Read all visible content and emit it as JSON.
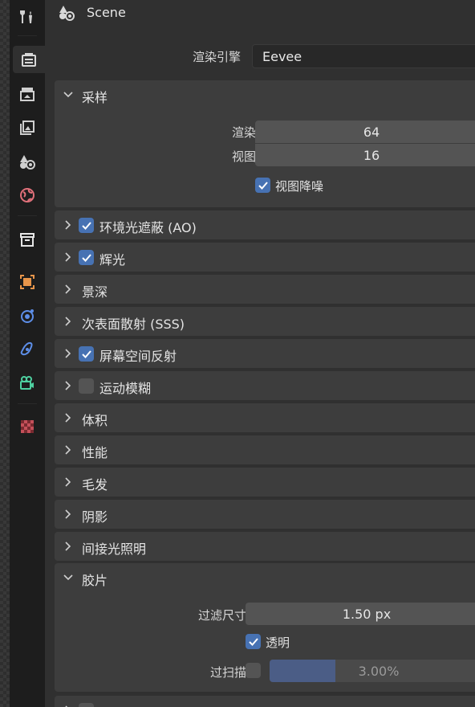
{
  "header": {
    "title": "Scene",
    "icon": "scene-icon"
  },
  "render_engine": {
    "label": "渲染引擎",
    "value": "Eevee"
  },
  "sampling": {
    "title": "采样",
    "render_label": "渲染",
    "render_value": "64",
    "viewport_label": "视图",
    "viewport_value": "16",
    "denoise_label": "视图降噪",
    "denoise_checked": true
  },
  "panels": [
    {
      "title": "环境光遮蔽 (AO)",
      "has_checkbox": true,
      "checked": true
    },
    {
      "title": "辉光",
      "has_checkbox": true,
      "checked": true
    },
    {
      "title": "景深",
      "has_checkbox": false
    },
    {
      "title": "次表面散射 (SSS)",
      "has_checkbox": false
    },
    {
      "title": "屏幕空间反射",
      "has_checkbox": true,
      "checked": true
    },
    {
      "title": "运动模糊",
      "has_checkbox": true,
      "checked": false
    },
    {
      "title": "体积",
      "has_checkbox": false
    },
    {
      "title": "性能",
      "has_checkbox": false
    },
    {
      "title": "毛发",
      "has_checkbox": false
    },
    {
      "title": "阴影",
      "has_checkbox": false
    },
    {
      "title": "间接光照明",
      "has_checkbox": false
    }
  ],
  "film": {
    "title": "胶片",
    "filter_label": "过滤尺寸",
    "filter_value": "1.50 px",
    "transparent_label": "透明",
    "transparent_checked": true,
    "overscan_label": "过扫描",
    "overscan_checked": false,
    "overscan_value": "3.00%",
    "overscan_fraction": 0.3
  },
  "colors": {
    "accent": "#4772b3",
    "panel": "#3d3d3d",
    "field": "#545454",
    "tabbar": "#1d1d1d"
  },
  "tabs": [
    "tool-icon",
    "render-icon",
    "output-icon",
    "view-layer-icon",
    "scene-icon",
    "world-icon",
    "collection-icon",
    "object-icon",
    "physics-icon",
    "constraints-icon",
    "object-data-icon",
    "texture-icon"
  ]
}
